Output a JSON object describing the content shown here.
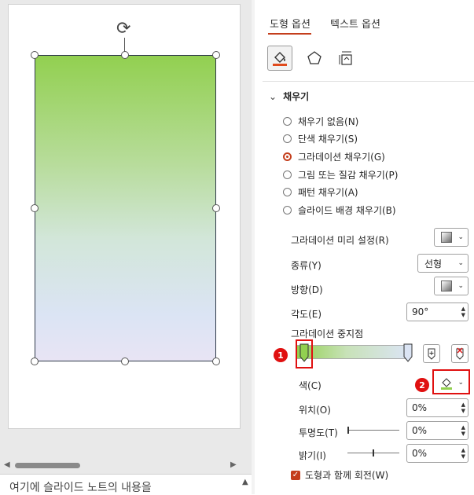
{
  "tabs": {
    "shape_options": "도형 옵션",
    "text_options": "텍스트 옵션"
  },
  "icons": {
    "fill": "fill-line-icon",
    "effects": "pentagon-effects-icon",
    "size": "size-properties-icon"
  },
  "fill_section": {
    "header": "채우기",
    "options": [
      {
        "label": "채우기 없음(N)",
        "selected": false
      },
      {
        "label": "단색 채우기(S)",
        "selected": false
      },
      {
        "label": "그라데이션 채우기(G)",
        "selected": true
      },
      {
        "label": "그림 또는 질감 채우기(P)",
        "selected": false
      },
      {
        "label": "패턴 채우기(A)",
        "selected": false
      },
      {
        "label": "슬라이드 배경 채우기(B)",
        "selected": false
      }
    ]
  },
  "gradient": {
    "preset_label": "그라데이션 미리 설정(R)",
    "type_label": "종류(Y)",
    "type_value": "선형",
    "direction_label": "방향(D)",
    "angle_label": "각도(E)",
    "angle_value": "90°",
    "stops_label": "그라데이션 중지점",
    "color_label": "색(C)",
    "position_label": "위치(O)",
    "position_value": "0%",
    "transparency_label": "투명도(T)",
    "transparency_value": "0%",
    "brightness_label": "밝기(I)",
    "brightness_value": "0%",
    "rotate_label": "도형과 함께 회전(W)",
    "rotate_checked": true,
    "start_color": "#92d050",
    "end_color": "#dbe4f4"
  },
  "annotations": {
    "badge1": "1",
    "badge2": "2"
  },
  "notes": {
    "placeholder": "여기에 슬라이드 노트의 내용을"
  },
  "colors": {
    "accent": "#c43e1c",
    "highlight_red": "#e01010"
  }
}
